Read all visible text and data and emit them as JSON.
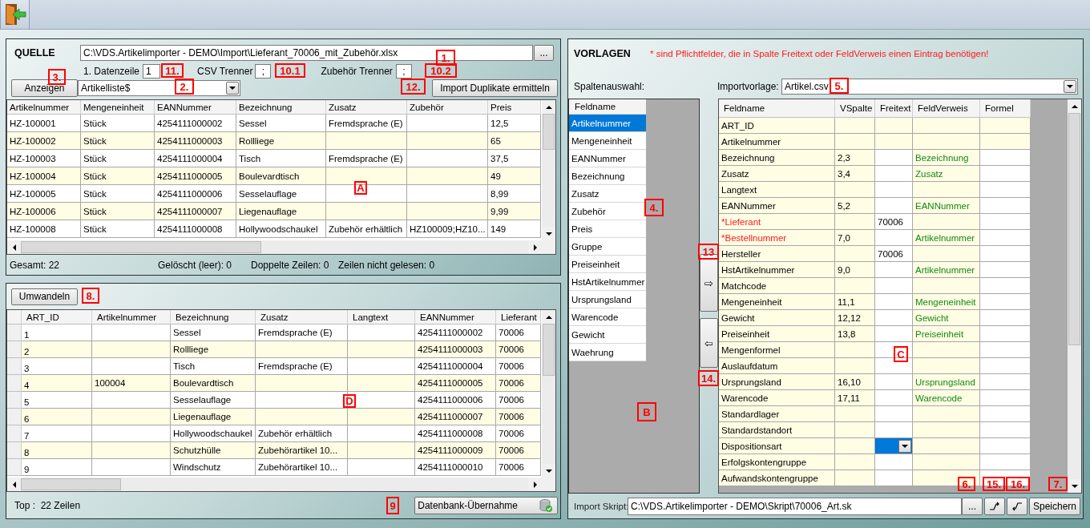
{
  "source": {
    "title": "QUELLE",
    "file_path": "C:\\VDS.Artikelimporter - DEMO\\Import\\Lieferant_70006_mit_Zubehör.xlsx",
    "browse_button": "...",
    "first_data_row": {
      "label": "1. Datenzeile",
      "value": "1"
    },
    "csv_separator": {
      "label": "CSV Trenner",
      "value": ";"
    },
    "accessory_separator": {
      "label": "Zubehör Trenner",
      "value": ";"
    },
    "show_button": "Anzeigen",
    "sheet": "Artikelliste$",
    "duplicates_button": "Import Duplikate ermitteln",
    "table": {
      "columns": [
        "Artikelnummer",
        "Mengeneinheit",
        "EANNummer",
        "Bezeichnung",
        "Zusatz",
        "Zubehör",
        "Preis"
      ],
      "rows": [
        [
          "HZ-100001",
          "Stück",
          "4254111000002",
          "Sessel",
          "Fremdsprache (E)",
          null,
          "12,5"
        ],
        [
          "HZ-100002",
          "Stück",
          "4254111000003",
          "Rollliege",
          null,
          null,
          "65"
        ],
        [
          "HZ-100003",
          "Stück",
          "4254111000004",
          "Tisch",
          "Fremdsprache (E)",
          null,
          "37,5"
        ],
        [
          "HZ-100004",
          "Stück",
          "4254111000005",
          "Boulevardtisch",
          null,
          null,
          "49"
        ],
        [
          "HZ-100005",
          "Stück",
          "4254111000006",
          "Sesselauflage",
          null,
          null,
          "8,99"
        ],
        [
          "HZ-100006",
          "Stück",
          "4254111000007",
          "Liegenauflage",
          null,
          null,
          "9,99"
        ],
        [
          "HZ-100008",
          "Stück",
          "4254111000008",
          "Hollywoodschaukel",
          "Zubehör erhältlich",
          "HZ100009;HZ10...",
          "149"
        ]
      ]
    },
    "status": [
      "Gesamt: 22",
      "Gelöscht (leer): 0",
      "Doppelte Zeilen: 0",
      "Zeilen nicht gelesen: 0"
    ]
  },
  "result": {
    "convert_button": "Umwandeln",
    "table": {
      "columns": [
        "ART_ID",
        "Artikelnummer",
        "Bezeichnung",
        "Zusatz",
        "Langtext",
        "EANNummer",
        "Lieferant"
      ],
      "rows": [
        [
          "1",
          null,
          "Sessel",
          "Fremdsprache (E)",
          null,
          "4254111000002",
          "70006"
        ],
        [
          "2",
          null,
          "Rollliege",
          null,
          null,
          "4254111000003",
          "70006"
        ],
        [
          "3",
          null,
          "Tisch",
          "Fremdsprache (E)",
          null,
          "4254111000004",
          "70006"
        ],
        [
          "4",
          "100004",
          "Boulevardtisch",
          null,
          null,
          "4254111000005",
          "70006"
        ],
        [
          "5",
          null,
          "Sesselauflage",
          null,
          null,
          "4254111000006",
          "70006"
        ],
        [
          "6",
          null,
          "Liegenauflage",
          null,
          null,
          "4254111000007",
          "70006"
        ],
        [
          "7",
          null,
          "Hollywoodschaukel",
          "Zubehör erhältlich",
          null,
          "4254111000008",
          "70006"
        ],
        [
          "8",
          null,
          "Schutzhülle",
          "Zubehörartikel 10...",
          null,
          "4254111000009",
          "70006"
        ],
        [
          "9",
          null,
          "Windschutz",
          "Zubehörartikel 10...",
          null,
          "4254111000010",
          "70006"
        ]
      ]
    },
    "status": "Top :  22 Zeilen",
    "import_button": "Datenbank-Übernahme"
  },
  "templates": {
    "title": "VORLAGEN",
    "note": "* sind Pflichtfelder, die in Spalte Freitext oder FeldVerweis einen Eintrag benötigen!",
    "column_select_label": "Spaltenauswahl:",
    "template_label": "Importvorlage:",
    "template": "Artikel.csv",
    "field_list": {
      "header": "Feldname",
      "items": [
        {
          "label": "Artikelnummer",
          "selected": true
        },
        {
          "label": "Mengeneinheit",
          "selected": false
        },
        {
          "label": "EANNummer",
          "selected": false
        },
        {
          "label": "Bezeichnung",
          "selected": false
        },
        {
          "label": "Zusatz",
          "selected": false
        },
        {
          "label": "Zubehör",
          "selected": false
        },
        {
          "label": "Preis",
          "selected": false
        },
        {
          "label": "Gruppe",
          "selected": false
        },
        {
          "label": "Preiseinheit",
          "selected": false
        },
        {
          "label": "HstArtikelnummer",
          "selected": false
        },
        {
          "label": "Ursprungsland",
          "selected": false
        },
        {
          "label": "Warencode",
          "selected": false
        },
        {
          "label": "Gewicht",
          "selected": false
        },
        {
          "label": "Waehrung",
          "selected": false
        }
      ]
    },
    "move_buttons": [
      "⇨",
      "⇦"
    ],
    "mapping": {
      "columns": [
        "Feldname",
        "VSpalte",
        "Freitext",
        "FeldVerweis",
        "Formel"
      ],
      "rows": [
        {
          "field": "ART_ID",
          "required": false,
          "locked": true,
          "selected": false
        },
        {
          "field": "Artikelnummer",
          "required": false,
          "locked": true,
          "selected": false
        },
        {
          "field": "Bezeichnung",
          "vspalte": "2,3",
          "feldverweis": "Bezeichnung",
          "required": false,
          "locked": false,
          "selected": false
        },
        {
          "field": "Zusatz",
          "vspalte": "3,4",
          "feldverweis": "Zusatz",
          "required": false,
          "locked": false,
          "selected": false
        },
        {
          "field": "Langtext",
          "required": false,
          "locked": false,
          "selected": false
        },
        {
          "field": "EANNummer",
          "vspalte": "5,2",
          "feldverweis": "EANNummer",
          "required": false,
          "locked": false,
          "selected": false
        },
        {
          "field": "*Lieferant",
          "freitext": "70006",
          "required": true,
          "locked": false,
          "selected": false
        },
        {
          "field": "*Bestellnummer",
          "vspalte": "7,0",
          "feldverweis": "Artikelnummer",
          "required": true,
          "locked": false,
          "selected": false
        },
        {
          "field": "Hersteller",
          "freitext": "70006",
          "required": false,
          "locked": false,
          "selected": false
        },
        {
          "field": "HstArtikelnummer",
          "vspalte": "9,0",
          "feldverweis": "Artikelnummer",
          "required": false,
          "locked": false,
          "selected": false
        },
        {
          "field": "Matchcode",
          "required": false,
          "locked": false,
          "selected": false
        },
        {
          "field": "Mengeneinheit",
          "vspalte": "11,1",
          "feldverweis": "Mengeneinheit",
          "required": false,
          "locked": false,
          "selected": false
        },
        {
          "field": "Gewicht",
          "vspalte": "12,12",
          "feldverweis": "Gewicht",
          "required": false,
          "locked": false,
          "selected": false
        },
        {
          "field": "Preiseinheit",
          "vspalte": "13,8",
          "feldverweis": "Preiseinheit",
          "required": false,
          "locked": false,
          "selected": false
        },
        {
          "field": "Mengenformel",
          "required": false,
          "locked": false,
          "selected": false
        },
        {
          "field": "Auslaufdatum",
          "required": false,
          "locked": false,
          "selected": false
        },
        {
          "field": "Ursprungsland",
          "vspalte": "16,10",
          "feldverweis": "Ursprungsland",
          "required": false,
          "locked": false,
          "selected": false
        },
        {
          "field": "Warencode",
          "vspalte": "17,11",
          "feldverweis": "Warencode",
          "required": false,
          "locked": false,
          "selected": false
        },
        {
          "field": "Standardlager",
          "required": false,
          "locked": false,
          "selected": false
        },
        {
          "field": "Standardstandort",
          "required": false,
          "locked": false,
          "selected": false
        },
        {
          "field": "Dispositionsart",
          "required": false,
          "locked": false,
          "selected": true
        },
        {
          "field": "Erfolgskontengruppe",
          "required": false,
          "locked": false,
          "selected": false
        },
        {
          "field": "Aufwandskontengruppe",
          "required": false,
          "locked": false,
          "selected": false
        }
      ]
    },
    "script_label": "Import Skript:",
    "script_path": "C:\\VDS.Artikelimporter - DEMO\\Skript\\70006_Art.sk",
    "browse_button": "...",
    "save_button": "Speichern"
  },
  "markers": [
    {
      "label": "11."
    },
    {
      "label": "10.1"
    },
    {
      "label": "10.2"
    },
    {
      "label": "1."
    },
    {
      "label": "3."
    },
    {
      "label": "2."
    },
    {
      "label": "12."
    },
    {
      "label": "A"
    },
    {
      "label": "8."
    },
    {
      "label": "9"
    },
    {
      "label": "D"
    },
    {
      "label": "5."
    },
    {
      "label": "4."
    },
    {
      "label": "13"
    },
    {
      "label": "14."
    },
    {
      "label": "B"
    },
    {
      "label": "C"
    },
    {
      "label": "6."
    },
    {
      "label": "15."
    },
    {
      "label": "16."
    },
    {
      "label": "7."
    }
  ]
}
